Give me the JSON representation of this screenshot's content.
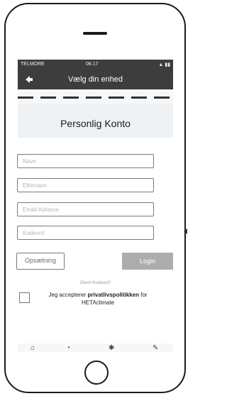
{
  "status_bar": {
    "carrier": "TELMORE",
    "time": "08.17"
  },
  "header": {
    "title": "Vælg din enhed",
    "back_icon": "back-arrow-icon"
  },
  "card": {
    "title": "Personlig Konto"
  },
  "form": {
    "name_placeholder": "Navn",
    "lastname_placeholder": "Efternavn",
    "email_placeholder": "Email Adresse",
    "password_placeholder": "Kodeord",
    "setup_button": "Opsætning",
    "login_button": "Login",
    "forgot_password": "Glemt Kodeord?",
    "consent_prefix": "Jeg accepterer ",
    "consent_link": "privatlivspolitikken",
    "consent_suffix": " for HETAclimate"
  },
  "tabs": [
    {
      "icon": "home-icon"
    },
    {
      "icon": "device-icon"
    },
    {
      "icon": "settings-icon"
    },
    {
      "icon": "edit-icon"
    }
  ],
  "colors": {
    "appbar": "#3d3d3d",
    "login_button": "#adadad",
    "headband": "#eef2f5"
  }
}
